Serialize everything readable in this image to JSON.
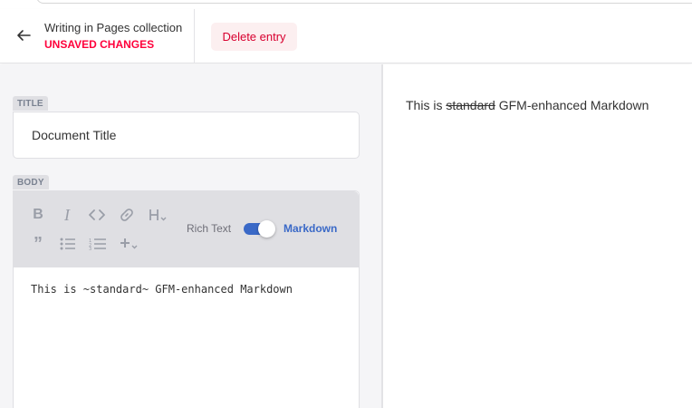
{
  "header": {
    "back_title": "Writing in Pages collection",
    "status": "UNSAVED CHANGES",
    "delete_label": "Delete entry"
  },
  "fields": {
    "title_label": "TITLE",
    "title_value": "Document Title",
    "body_label": "BODY"
  },
  "toolbar": {
    "buttons": [
      "bold-icon",
      "italic-icon",
      "code-icon",
      "link-icon",
      "heading-icon",
      "quote-icon",
      "bulleted-list-icon",
      "numbered-list-icon",
      "add-icon"
    ],
    "rich_text_label": "Rich Text",
    "markdown_label": "Markdown",
    "mode_toggle_on": true
  },
  "editor": {
    "markdown": "This is ~standard~ GFM-enhanced Markdown"
  },
  "preview": {
    "before": "This is ",
    "strike": "standard",
    "after": " GFM-enhanced Markdown"
  },
  "colors": {
    "accent": "#3a69c7",
    "danger": "#ff003b",
    "delete_bg": "#fceff0"
  }
}
